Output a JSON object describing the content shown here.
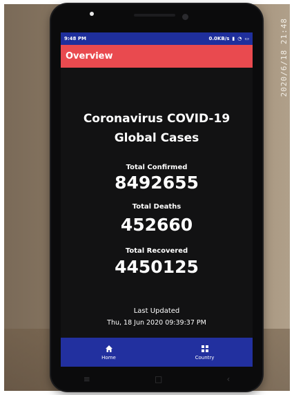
{
  "photo": {
    "timestamp": "2020/6/18  21:48"
  },
  "status_bar": {
    "time": "9:48 PM",
    "net_speed": "0.0KB/s"
  },
  "app_bar": {
    "title": "Overview"
  },
  "overview": {
    "title_line1": "Coronavirus COVID-19",
    "title_line2": "Global Cases",
    "confirmed_label": "Total Confirmed",
    "confirmed_value": "8492655",
    "deaths_label": "Total Deaths",
    "deaths_value": "452660",
    "recovered_label": "Total Recovered",
    "recovered_value": "4450125",
    "updated_label": "Last Updated",
    "updated_value": "Thu, 18 Jun 2020 09:39:37 PM"
  },
  "bottom_nav": {
    "items": [
      {
        "label": "Home",
        "icon": "home-icon"
      },
      {
        "label": "Country",
        "icon": "country-icon"
      }
    ]
  },
  "colors": {
    "status_bar": "#1f2f9c",
    "app_bar": "#e94a4f",
    "screen_bg": "#121213",
    "bottom_nav": "#22309f"
  }
}
